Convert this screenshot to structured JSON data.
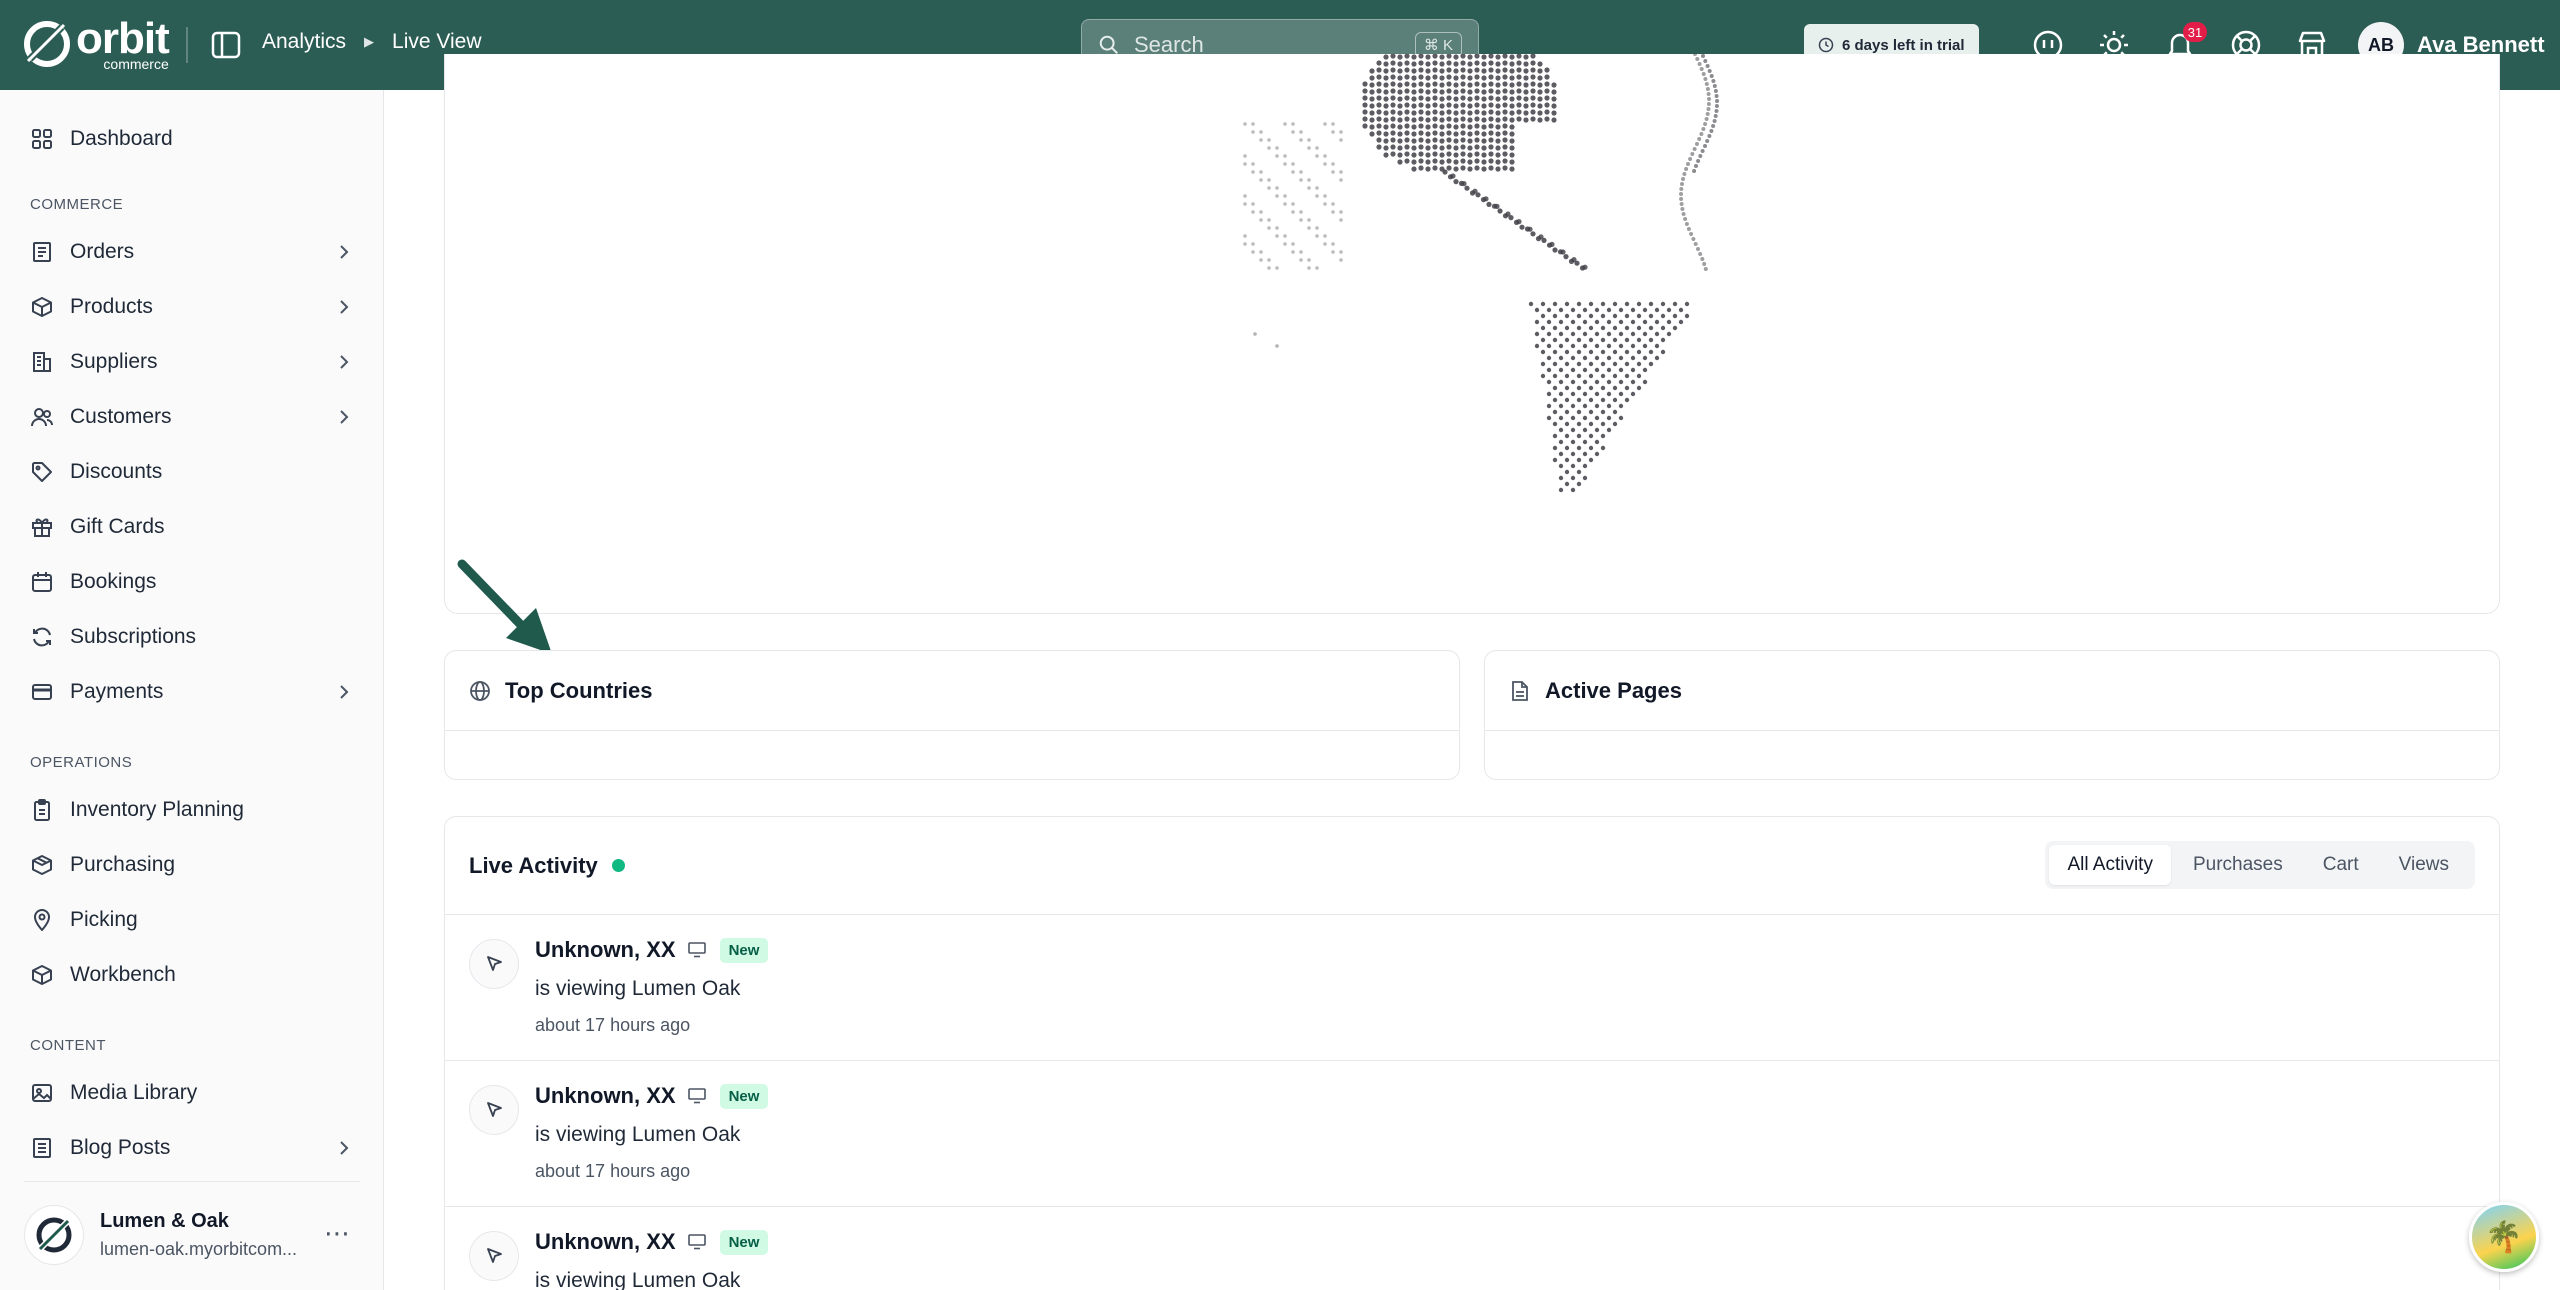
{
  "topbar": {
    "logo_text": "orbit",
    "logo_sub": "commerce",
    "breadcrumb": [
      "Analytics",
      "Live View"
    ],
    "search_placeholder": "Search",
    "search_shortcut": "⌘ K",
    "trial_text": "6 days left in trial",
    "notification_count": "31",
    "user_initials": "AB",
    "user_name": "Ava Bennett"
  },
  "sidebar": {
    "dashboard": "Dashboard",
    "sections": {
      "commerce": "COMMERCE",
      "operations": "OPERATIONS",
      "content": "CONTENT"
    },
    "commerce_items": [
      {
        "label": "Orders",
        "icon": "orders-icon",
        "expandable": true
      },
      {
        "label": "Products",
        "icon": "box-icon",
        "expandable": true
      },
      {
        "label": "Suppliers",
        "icon": "building-icon",
        "expandable": true
      },
      {
        "label": "Customers",
        "icon": "users-icon",
        "expandable": true
      },
      {
        "label": "Discounts",
        "icon": "tag-icon",
        "expandable": false
      },
      {
        "label": "Gift Cards",
        "icon": "gift-icon",
        "expandable": false
      },
      {
        "label": "Bookings",
        "icon": "calendar-icon",
        "expandable": false
      },
      {
        "label": "Subscriptions",
        "icon": "refresh-icon",
        "expandable": false
      },
      {
        "label": "Payments",
        "icon": "credit-card-icon",
        "expandable": true
      }
    ],
    "operations_items": [
      {
        "label": "Inventory Planning",
        "icon": "clipboard-icon"
      },
      {
        "label": "Purchasing",
        "icon": "package-icon"
      },
      {
        "label": "Picking",
        "icon": "map-pin-icon"
      },
      {
        "label": "Workbench",
        "icon": "box-icon"
      }
    ],
    "content_items": [
      {
        "label": "Media Library",
        "icon": "image-icon",
        "expandable": false
      },
      {
        "label": "Blog Posts",
        "icon": "document-icon",
        "expandable": true
      }
    ],
    "store": {
      "name": "Lumen & Oak",
      "url": "lumen-oak.myorbitcom..."
    }
  },
  "main": {
    "top_countries_title": "Top Countries",
    "active_pages_title": "Active Pages",
    "live_activity": {
      "title": "Live Activity",
      "status_color": "#10b981",
      "tabs": [
        "All Activity",
        "Purchases",
        "Cart",
        "Views"
      ],
      "active_tab": "All Activity",
      "items": [
        {
          "name": "Unknown, XX",
          "badge": "New",
          "desc": "is viewing Lumen Oak",
          "time": "about 17 hours ago"
        },
        {
          "name": "Unknown, XX",
          "badge": "New",
          "desc": "is viewing Lumen Oak",
          "time": "about 17 hours ago"
        },
        {
          "name": "Unknown, XX",
          "badge": "New",
          "desc": "is viewing Lumen Oak",
          "time": ""
        }
      ]
    }
  },
  "colors": {
    "topbar": "#2c5d54",
    "accent_green": "#1f5a4d",
    "new_badge_bg": "#d1fae5",
    "notification": "#e11d48"
  }
}
